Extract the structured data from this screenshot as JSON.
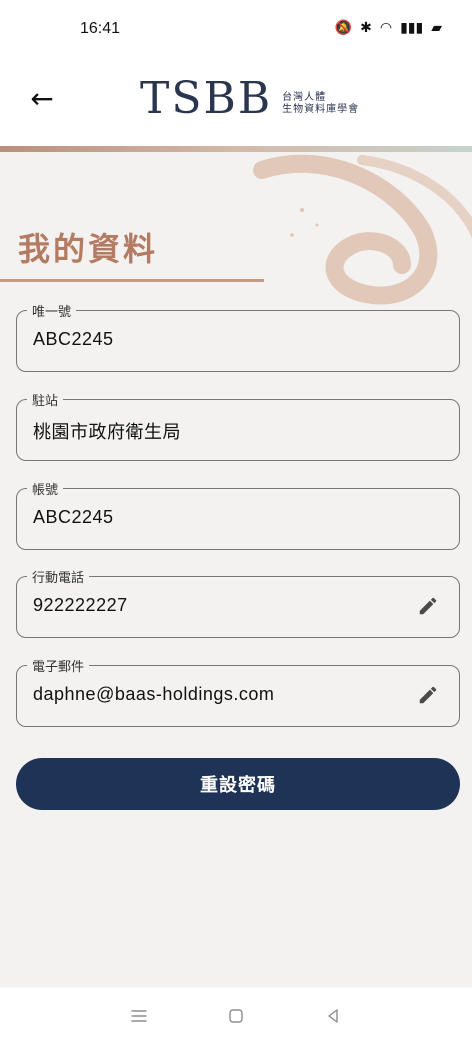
{
  "status": {
    "time": "16:41"
  },
  "logo": {
    "mark": "TSBB",
    "line1": "台灣人體",
    "line2": "生物資料庫學會"
  },
  "page": {
    "title": "我的資料"
  },
  "fields": [
    {
      "label": "唯一號",
      "value": "ABC2245",
      "editable": false
    },
    {
      "label": "駐站",
      "value": "桃園市政府衛生局",
      "editable": false
    },
    {
      "label": "帳號",
      "value": "ABC2245",
      "editable": false
    },
    {
      "label": "行動電話",
      "value": "922222227",
      "editable": true
    },
    {
      "label": "電子郵件",
      "value": "daphne@baas-holdings.com",
      "editable": true
    }
  ],
  "actions": {
    "reset_password": "重設密碼"
  },
  "colors": {
    "accent": "#b47b63",
    "primary_button": "#1f3356"
  },
  "icons": [
    "back-arrow-icon",
    "pencil-icon",
    "menu-icon",
    "home-icon",
    "back-triangle-icon"
  ]
}
